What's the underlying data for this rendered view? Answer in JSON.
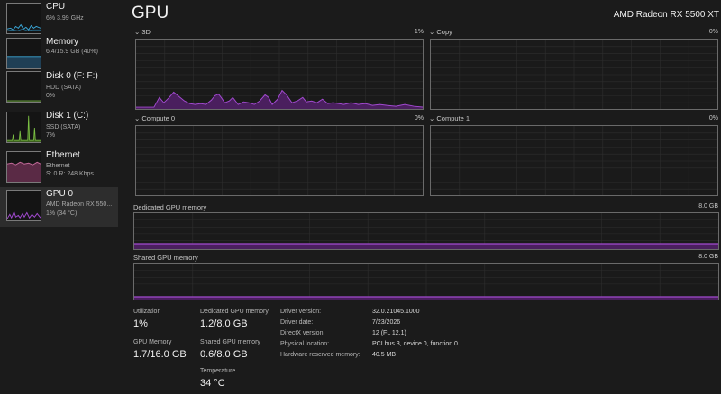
{
  "colors": {
    "cpu": "#3aa7d8",
    "memory": "#3aa7d8",
    "disk": "#7bc043",
    "ethernet": "#c46a9a",
    "gpu": "#a24ad0",
    "gpu_fill": "#4a1f5e"
  },
  "sidebar": {
    "items": [
      {
        "name": "CPU",
        "sub": "6% 3.99 GHz",
        "icon": "cpu-graph-icon"
      },
      {
        "name": "Memory",
        "sub": "6.4/15.9 GB (40%)",
        "icon": "memory-graph-icon"
      },
      {
        "name": "Disk 0 (F: F:)",
        "sub": "HDD (SATA)",
        "sub2": "0%",
        "icon": "disk-graph-icon"
      },
      {
        "name": "Disk 1 (C:)",
        "sub": "SSD (SATA)",
        "sub2": "7%",
        "icon": "disk-graph-icon"
      },
      {
        "name": "Ethernet",
        "sub": "Ethernet",
        "sub2": "S: 0 R: 248 Kbps",
        "icon": "ethernet-graph-icon"
      },
      {
        "name": "GPU 0",
        "sub": "AMD Radeon RX 550...",
        "sub2": "1% (34 °C)",
        "icon": "gpu-graph-icon"
      }
    ]
  },
  "header": {
    "title": "GPU",
    "model": "AMD Radeon RX 5500 XT"
  },
  "graphs": {
    "g3d": {
      "label": "3D",
      "pct": "1%"
    },
    "copy": {
      "label": "Copy",
      "pct": "0%"
    },
    "compute0": {
      "label": "Compute 0",
      "pct": "0%"
    },
    "compute1": {
      "label": "Compute 1",
      "pct": "0%"
    },
    "dedicated": {
      "label": "Dedicated GPU memory",
      "max": "8.0 GB",
      "level": 0.15
    },
    "shared": {
      "label": "Shared GPU memory",
      "max": "8.0 GB",
      "level": 0.075
    }
  },
  "stats": {
    "utilization_label": "Utilization",
    "utilization_value": "1%",
    "gpu_memory_label": "GPU Memory",
    "gpu_memory_value": "1.7/16.0 GB",
    "dedicated_label": "Dedicated GPU memory",
    "dedicated_value": "1.2/8.0 GB",
    "shared_label": "Shared GPU memory",
    "shared_value": "0.6/8.0 GB",
    "temperature_label": "Temperature",
    "temperature_value": "34 °C"
  },
  "info": {
    "driver_version_label": "Driver version:",
    "driver_version": "32.0.21045.1000",
    "driver_date_label": "Driver date:",
    "driver_date": "7/23/2026",
    "directx_label": "DirectX version:",
    "directx": "12 (FL 12.1)",
    "location_label": "Physical location:",
    "location": "PCI bus 3, device 0, function 0",
    "reserved_label": "Hardware reserved memory:",
    "reserved": "40.5 MB"
  }
}
